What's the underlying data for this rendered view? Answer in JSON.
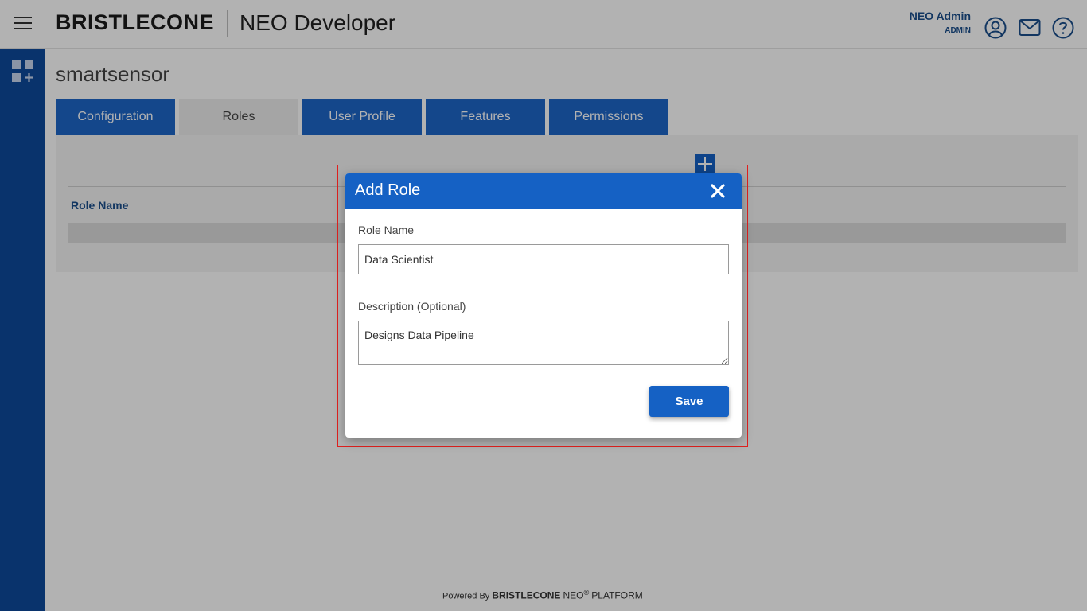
{
  "header": {
    "brand": "BRISTLECONE",
    "app_title": "NEO Developer",
    "user_name": "NEO Admin",
    "user_role": "ADMIN",
    "icons": [
      "menu-icon",
      "user-circle-icon",
      "mail-icon",
      "help-icon"
    ]
  },
  "sidebar": {
    "icon": "apps-add-icon"
  },
  "page": {
    "title": "smartsensor",
    "tabs": [
      {
        "label": "Configuration",
        "active": false
      },
      {
        "label": "Roles",
        "active": true
      },
      {
        "label": "User Profile",
        "active": false
      },
      {
        "label": "Features",
        "active": false
      },
      {
        "label": "Permissions",
        "active": false
      }
    ],
    "table": {
      "column_header": "Role Name"
    }
  },
  "modal": {
    "title": "Add Role",
    "role_name_label": "Role Name",
    "role_name_value": "Data Scientist",
    "description_label": "Description (Optional)",
    "description_value": "Designs Data Pipeline",
    "save_label": "Save"
  },
  "footer": {
    "powered_by": "Powered By",
    "brand": "BRISTLECONE",
    "neo": "NEO",
    "registered": "®",
    "platform": "PLATFORM"
  },
  "colors": {
    "primary": "#1561c4",
    "sidebar": "#0e4a9b",
    "text_link": "#1a4e8c",
    "highlight": "#e0201e"
  }
}
